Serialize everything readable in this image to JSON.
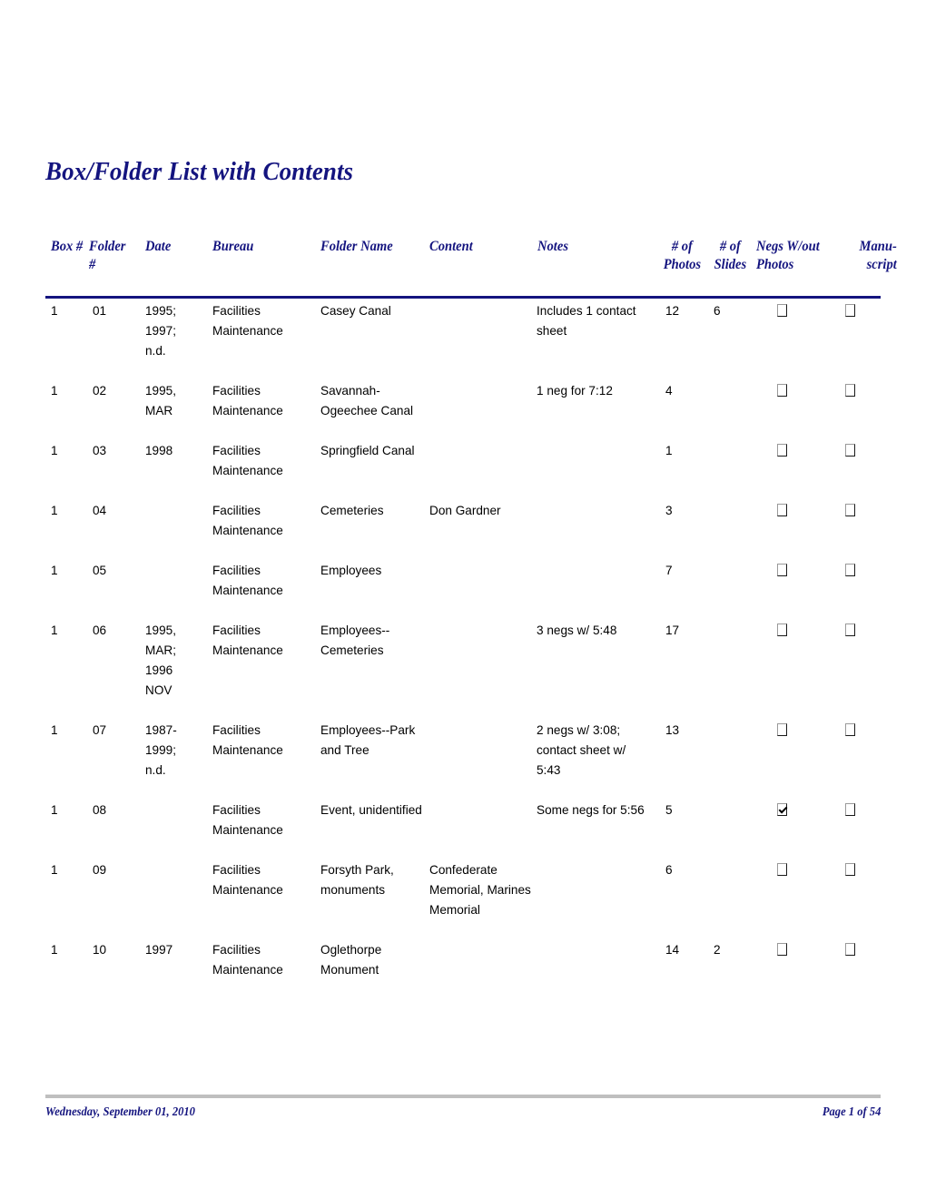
{
  "document": {
    "title": "Box/Folder List with Contents"
  },
  "table": {
    "columns": [
      {
        "key": "box",
        "label": "Box #"
      },
      {
        "key": "folder",
        "label": "Folder #"
      },
      {
        "key": "date",
        "label": "Date"
      },
      {
        "key": "bureau",
        "label": "Bureau"
      },
      {
        "key": "foldern",
        "label": "Folder Name"
      },
      {
        "key": "content",
        "label": "Content"
      },
      {
        "key": "notes",
        "label": "Notes"
      },
      {
        "key": "photos",
        "label": "# of\nPhotos"
      },
      {
        "key": "slides",
        "label": "# of\nSlides"
      },
      {
        "key": "negs",
        "label": "Negs W/out\nPhotos"
      },
      {
        "key": "manu",
        "label": "Manu-\nscript"
      }
    ],
    "rows": [
      {
        "box": "1",
        "folder": "01",
        "date": "1995;\n1997;\nn.d.",
        "bureau": "Facilities\nMaintenance",
        "foldern": "Casey Canal",
        "content": "",
        "notes": "Includes 1 contact\nsheet",
        "photos": "12",
        "slides": "6",
        "negs": false,
        "manu": false
      },
      {
        "box": "1",
        "folder": "02",
        "date": "1995,\nMAR",
        "bureau": "Facilities\nMaintenance",
        "foldern": "Savannah-\nOgeechee Canal",
        "content": "",
        "notes": "1 neg for 7:12",
        "photos": "4",
        "slides": "",
        "negs": false,
        "manu": false
      },
      {
        "box": "1",
        "folder": "03",
        "date": "1998",
        "bureau": "Facilities\nMaintenance",
        "foldern": "Springfield Canal",
        "content": "",
        "notes": "",
        "photos": "1",
        "slides": "",
        "negs": false,
        "manu": false
      },
      {
        "box": "1",
        "folder": "04",
        "date": "",
        "bureau": "Facilities\nMaintenance",
        "foldern": "Cemeteries",
        "content": "Don Gardner",
        "notes": "",
        "photos": "3",
        "slides": "",
        "negs": false,
        "manu": false
      },
      {
        "box": "1",
        "folder": "05",
        "date": "",
        "bureau": "Facilities\nMaintenance",
        "foldern": "Employees",
        "content": "",
        "notes": "",
        "photos": "7",
        "slides": "",
        "negs": false,
        "manu": false
      },
      {
        "box": "1",
        "folder": "06",
        "date": "1995,\nMAR;\n1996\nNOV",
        "bureau": "Facilities\nMaintenance",
        "foldern": "Employees--\nCemeteries",
        "content": "",
        "notes": "3 negs w/ 5:48",
        "photos": "17",
        "slides": "",
        "negs": false,
        "manu": false
      },
      {
        "box": "1",
        "folder": "07",
        "date": "1987-\n1999;\nn.d.",
        "bureau": "Facilities\nMaintenance",
        "foldern": "Employees--Park\nand Tree",
        "content": "",
        "notes": "2 negs w/ 3:08;\ncontact sheet w/\n5:43",
        "photos": "13",
        "slides": "",
        "negs": false,
        "manu": false
      },
      {
        "box": "1",
        "folder": "08",
        "date": "",
        "bureau": "Facilities\nMaintenance",
        "foldern": "Event, unidentified",
        "content": "",
        "notes": "Some negs for 5:56",
        "photos": "5",
        "slides": "",
        "negs": true,
        "manu": false
      },
      {
        "box": "1",
        "folder": "09",
        "date": "",
        "bureau": "Facilities\nMaintenance",
        "foldern": "Forsyth Park,\nmonuments",
        "content": "Confederate\nMemorial, Marines\nMemorial",
        "notes": "",
        "photos": "6",
        "slides": "",
        "negs": false,
        "manu": false
      },
      {
        "box": "1",
        "folder": "10",
        "date": "1997",
        "bureau": "Facilities\nMaintenance",
        "foldern": "Oglethorpe\nMonument",
        "content": "",
        "notes": "",
        "photos": "14",
        "slides": "2",
        "negs": false,
        "manu": false
      }
    ]
  },
  "footer": {
    "date": "Wednesday, September 01, 2010",
    "page": "Page 1 of 54"
  },
  "colors": {
    "accent": "#14147f",
    "text": "#000000",
    "footer_rule": "#bfbfbf"
  }
}
